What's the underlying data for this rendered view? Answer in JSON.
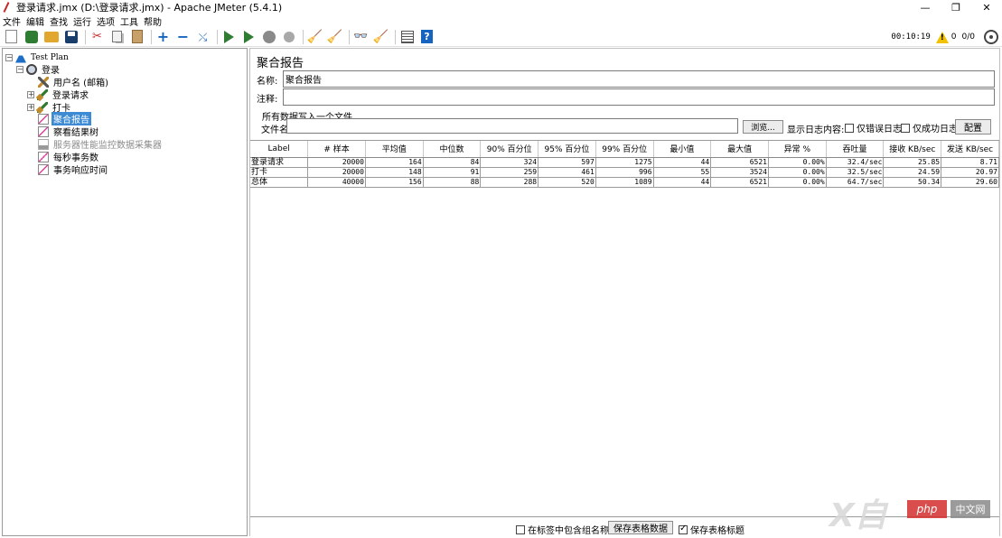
{
  "window": {
    "title": "登录请求.jmx (D:\\登录请求.jmx) - Apache JMeter (5.4.1)",
    "minimize": "—",
    "restore": "❐",
    "close": "✕"
  },
  "menu": [
    "文件",
    "编辑",
    "查找",
    "运行",
    "选项",
    "工具",
    "帮助"
  ],
  "toolbar": {
    "timer": "00:10:19",
    "warnings": "0",
    "threads": "0/0"
  },
  "tree": {
    "test_plan": "Test Plan",
    "thread_group": "登录",
    "items": {
      "user_name": "用户名 (邮箱)",
      "login_request": "登录请求",
      "clock_in": "打卡",
      "aggregate_report": "聚合报告",
      "view_results_tree": "察看结果树",
      "perfmon_collector": "服务器性能监控数据采集器",
      "tps": "每秒事务数",
      "response_time": "事务响应时间"
    }
  },
  "panel": {
    "title": "聚合报告",
    "name_label": "名称:",
    "name_value": "聚合报告",
    "comment_label": "注释:",
    "comment_value": "",
    "write_all_label": "所有数据写入一个文件",
    "filename_label": "文件名",
    "filename_value": "",
    "browse_button": "浏览...",
    "log_content_label": "显示日志内容:",
    "errors_only": "仅错误日志",
    "success_only": "仅成功日志",
    "configure_button": "配置"
  },
  "table": {
    "columns": [
      "Label",
      "# 样本",
      "平均值",
      "中位数",
      "90% 百分位",
      "95% 百分位",
      "99% 百分位",
      "最小值",
      "最大值",
      "异常 %",
      "吞吐量",
      "接收 KB/sec",
      "发送 KB/sec"
    ],
    "rows": [
      [
        "登录请求",
        "20000",
        "164",
        "84",
        "324",
        "597",
        "1275",
        "44",
        "6521",
        "0.00%",
        "32.4/sec",
        "25.85",
        "8.71"
      ],
      [
        "打卡",
        "20000",
        "148",
        "91",
        "259",
        "461",
        "996",
        "55",
        "3524",
        "0.00%",
        "32.5/sec",
        "24.59",
        "20.97"
      ],
      [
        "总体",
        "40000",
        "156",
        "88",
        "288",
        "520",
        "1089",
        "44",
        "6521",
        "0.00%",
        "64.7/sec",
        "50.34",
        "29.60"
      ]
    ]
  },
  "bottom": {
    "include_group_name": "在标签中包含组名称?",
    "include_group_name_checked": false,
    "save_table_button": "保存表格数据",
    "save_table_header": "保存表格标题",
    "save_table_header_checked": true
  },
  "watermark": {
    "x_text": "X自",
    "php_text": "php",
    "cn_text": "中文网"
  }
}
